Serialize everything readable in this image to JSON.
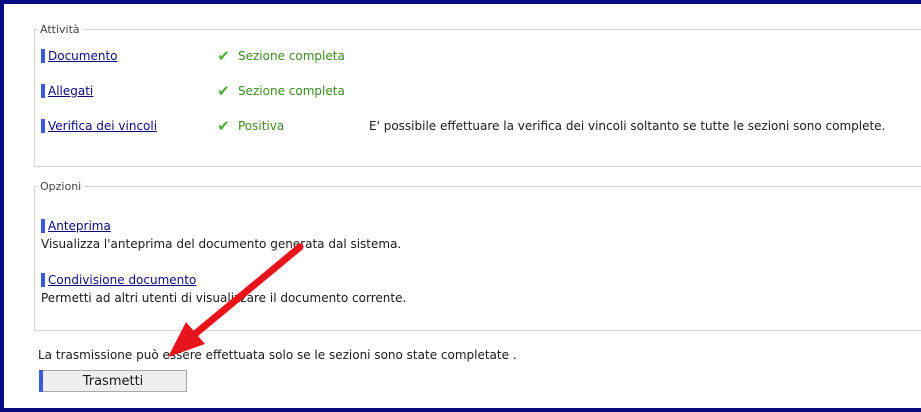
{
  "activity": {
    "legend": "Attività",
    "items": [
      {
        "label": "Documento",
        "status": "Sezione completa",
        "note": ""
      },
      {
        "label": "Allegati",
        "status": "Sezione completa",
        "note": ""
      },
      {
        "label": "Verifica dei vincoli",
        "status": "Positiva",
        "note": "E' possibile effettuare la verifica dei vincoli soltanto se tutte le sezioni sono complete."
      }
    ]
  },
  "options": {
    "legend": "Opzioni",
    "items": [
      {
        "label": "Anteprima",
        "description": "Visualizza l'anteprima del documento generata dal sistema."
      },
      {
        "label": "Condivisione documento",
        "description": "Permetti ad altri utenti di visualizzare il documento corrente."
      }
    ]
  },
  "footer": {
    "note": "La trasmissione può essere effettuata solo se le sezioni sono state completate .",
    "submit_label": "Trasmetti"
  },
  "icons": {
    "status": "check-icon",
    "annotation": "red-arrow-icon"
  },
  "colors": {
    "frame": "#0a0a80",
    "marker": "#3a5bd9",
    "check": "#4cae2f",
    "arrow": "#e8141b"
  }
}
